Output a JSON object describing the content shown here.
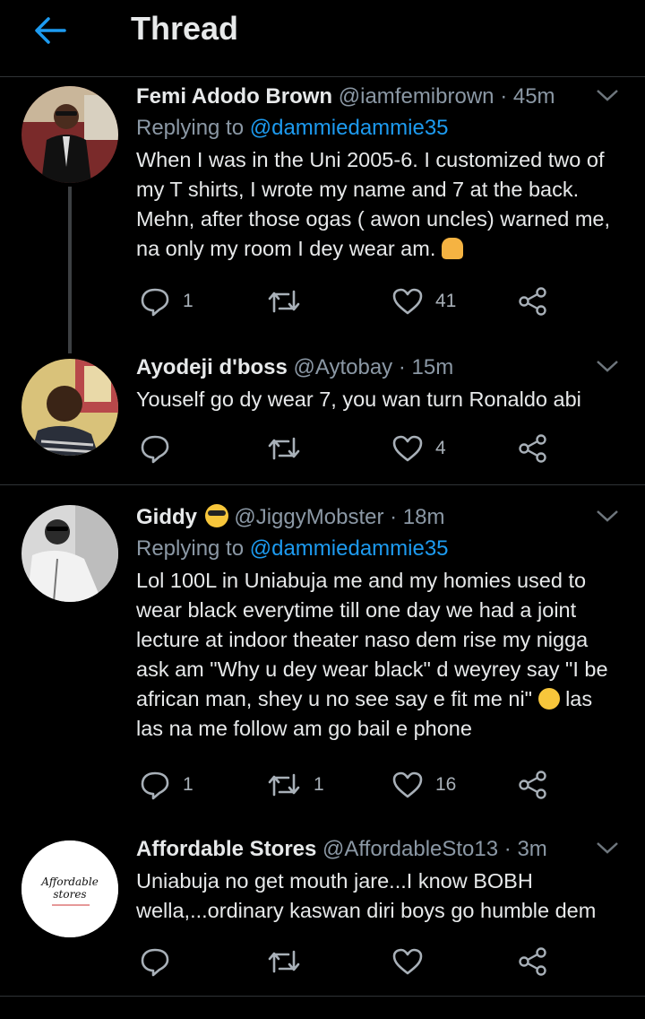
{
  "header": {
    "title": "Thread",
    "back_icon": "back-arrow-icon",
    "accent": "#1d9bf0"
  },
  "tweets": [
    {
      "name": "Femi Adodo Brown",
      "handle": "@iamfemibrown",
      "time": "· 45m",
      "replying_label": "Replying to",
      "replying_to": "@dammiedammie35",
      "text": "When I was in the Uni 2005-6. I customized two of my T shirts, I wrote my name and 7 at the back. Mehn, after those ogas ( awon uncles) warned me, na only my room I dey wear am.",
      "emoji": "person-facepalming-emoji",
      "replies": "1",
      "retweets": "",
      "likes": "41"
    },
    {
      "name": "Ayodeji d'boss",
      "handle": "@Aytobay",
      "time": "· 15m",
      "text": "Youself go dy wear 7, you wan turn Ronaldo abi",
      "replies": "",
      "retweets": "",
      "likes": "4"
    },
    {
      "name": "Giddy",
      "name_emoji": "sunglasses-emoji",
      "handle": "@JiggyMobster",
      "time": "· 18m",
      "replying_label": "Replying to",
      "replying_to": "@dammiedammie35",
      "text": "Lol 100L in Uniabuja me and my homies used to wear black everytime till one day we had a joint lecture at indoor theater naso dem rise my nigga ask am \"Why u dey wear black\" d weyrey say \"I be african man, shey u no see say e fit me ni\"",
      "text_emoji": "tears-of-joy-emoji",
      "text_tail": "las las na me follow am go bail e phone",
      "replies": "1",
      "retweets": "1",
      "likes": "16"
    },
    {
      "name": "Affordable Stores",
      "handle": "@AffordableSto13",
      "time": "· 3m",
      "text": "Uniabuja no get mouth jare...I know BOBH wella,...ordinary kaswan diri boys go humble dem",
      "avatar_logo": "Affordable stores",
      "replies": "",
      "retweets": "",
      "likes": ""
    }
  ],
  "icons": [
    "reply-icon",
    "retweet-icon",
    "like-icon",
    "share-icon",
    "chevron-down-icon"
  ]
}
